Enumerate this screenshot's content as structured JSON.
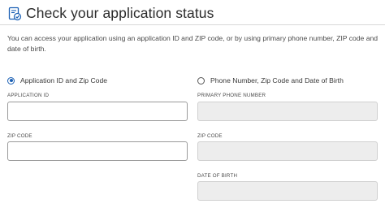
{
  "header": {
    "title": "Check your application status",
    "icon": "document-check-icon"
  },
  "intro_text": "You can access your application using an application ID and ZIP code, or by using primary phone number, ZIP code and date of birth.",
  "colors": {
    "accent": "#1a5fb4",
    "disabled_field": "#ededed"
  },
  "options": {
    "application": {
      "label": "Application ID and Zip Code",
      "selected": true,
      "fields": {
        "application_id": {
          "label": "APPLICATION ID",
          "value": "",
          "placeholder": ""
        },
        "zip_code": {
          "label": "ZIP CODE",
          "value": "",
          "placeholder": ""
        }
      }
    },
    "phone": {
      "label": "Phone Number, Zip Code and Date of Birth",
      "selected": false,
      "fields": {
        "primary_phone": {
          "label": "PRIMARY PHONE NUMBER",
          "value": "",
          "placeholder": ""
        },
        "zip_code": {
          "label": "ZIP CODE",
          "value": "",
          "placeholder": ""
        },
        "date_of_birth": {
          "label": "DATE OF BIRTH",
          "value": "",
          "placeholder": ""
        }
      }
    }
  }
}
